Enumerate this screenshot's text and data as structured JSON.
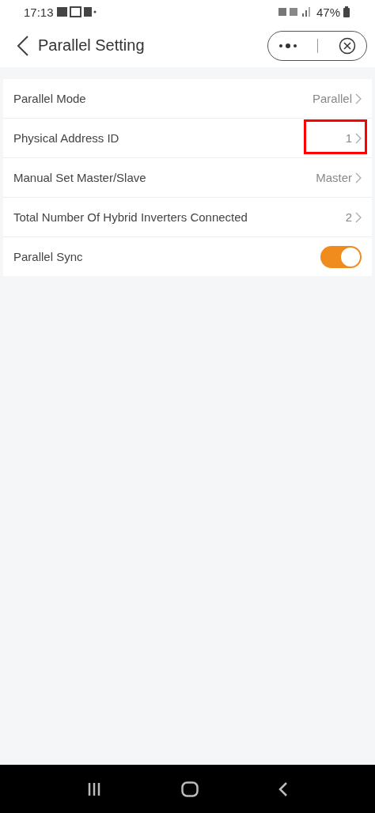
{
  "status_bar": {
    "time": "17:13",
    "battery": "47%"
  },
  "header": {
    "title": "Parallel Setting"
  },
  "settings": [
    {
      "kind": "value",
      "label": "Parallel Mode",
      "value": "Parallel",
      "highlighted": false
    },
    {
      "kind": "value",
      "label": "Physical Address ID",
      "value": "1",
      "highlighted": true
    },
    {
      "kind": "value",
      "label": "Manual Set Master/Slave",
      "value": "Master",
      "highlighted": false
    },
    {
      "kind": "value",
      "label": "Total Number Of Hybrid Inverters Connected",
      "value": "2",
      "highlighted": false
    },
    {
      "kind": "toggle",
      "label": "Parallel Sync",
      "on": true
    }
  ]
}
